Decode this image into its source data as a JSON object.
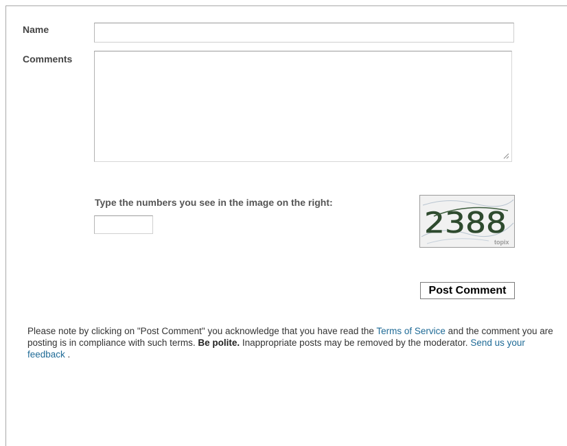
{
  "form": {
    "name_label": "Name",
    "name_value": "",
    "comments_label": "Comments",
    "comments_value": "",
    "captcha_prompt": "Type the numbers you see in the image on the right:",
    "captcha_value": "",
    "captcha_image_text": "2388",
    "captcha_brand": "topix",
    "post_button_label": "Post Comment"
  },
  "notice": {
    "text_1": "Please note by clicking on \"Post Comment\" you acknowledge that you have read the ",
    "terms_link": "Terms of Service",
    "text_2": " and the comment you are posting is in compliance with such terms. ",
    "be_polite": "Be polite.",
    "text_3": " Inappropriate posts may be removed by the moderator. ",
    "feedback_link": "Send us your feedback",
    "text_4": " ."
  },
  "colors": {
    "link": "#1e6a96",
    "label": "#444444",
    "text": "#333333"
  }
}
